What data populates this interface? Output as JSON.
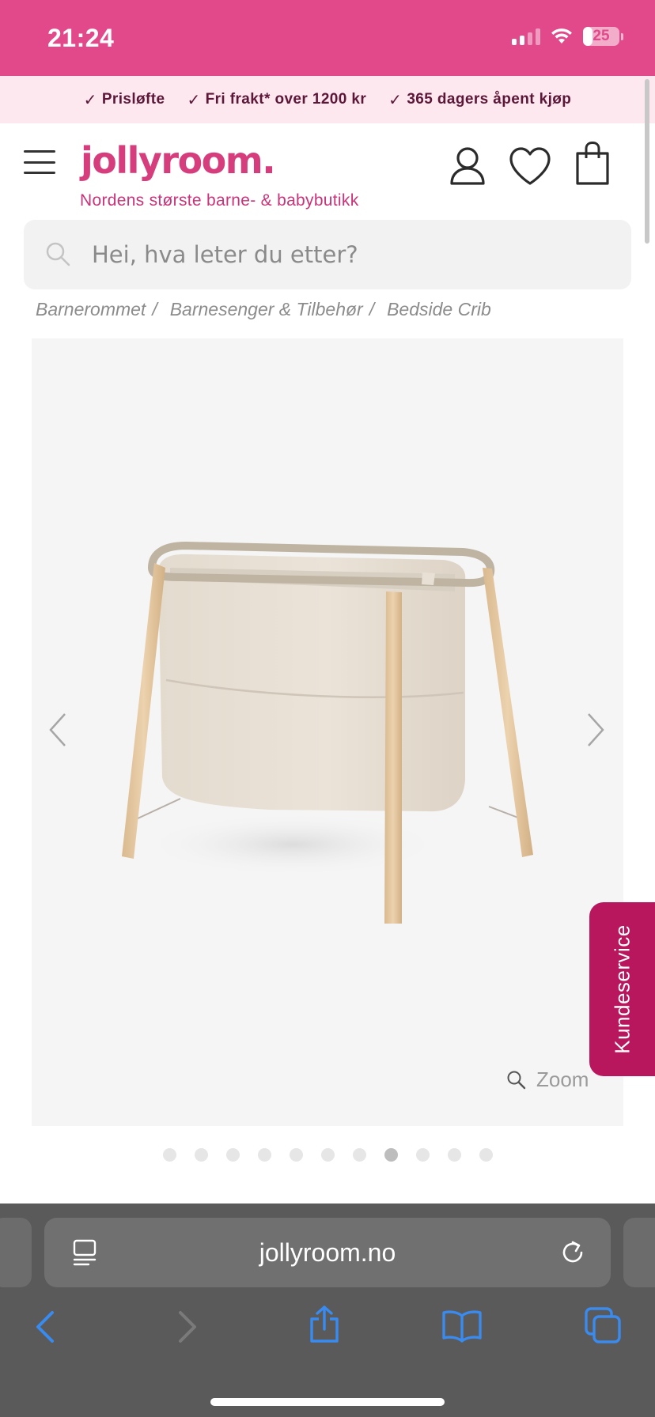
{
  "status_bar": {
    "time": "21:24",
    "battery": "25",
    "battery_level": 0.25
  },
  "usp": [
    {
      "label": "Prisløfte"
    },
    {
      "label": "Fri frakt* over 1200 kr"
    },
    {
      "label": "365 dagers åpent kjøp"
    }
  ],
  "header": {
    "logo": "jollyroom.",
    "tagline": "Nordens største barne- & babybutikk",
    "icons": [
      "user-icon",
      "heart-icon",
      "shopping-bag-icon"
    ]
  },
  "search": {
    "placeholder": "Hei, hva leter du etter?"
  },
  "breadcrumb": [
    {
      "label": "Barnerommet"
    },
    {
      "label": "Barnesenger & Tilbehør"
    },
    {
      "label": "Bedside Crib"
    }
  ],
  "gallery": {
    "zoom_label": "Zoom",
    "slide_count": 11,
    "active_slide": 8
  },
  "kundeservice": {
    "label": "Kundeservice"
  },
  "browser": {
    "url": "jollyroom.no"
  },
  "colors": {
    "brand": "#e2498a",
    "brand_dark": "#b8165d",
    "usp_bg": "#fce8ee"
  }
}
